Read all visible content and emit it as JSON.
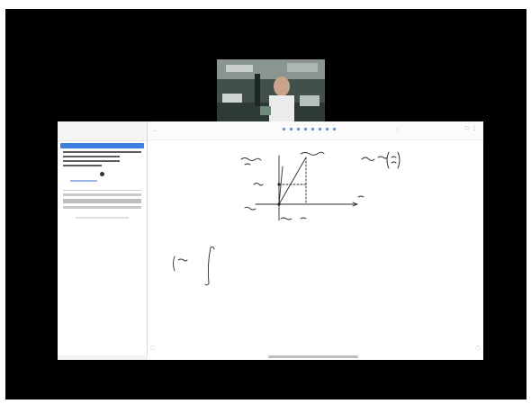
{
  "app": {
    "mode": "screen-recording",
    "accent_color": "#3d7fe0"
  },
  "webcam": {
    "icon": "person-webcam-icon"
  },
  "sidebar": {
    "top_text": "",
    "active_item": ""
  },
  "toolbar": {
    "left_icon": "back-arrow-icon",
    "tools": [
      "pen-icon",
      "eraser-icon",
      "shape-icon",
      "text-icon",
      "select-icon",
      "color-icon",
      "undo-icon",
      "redo-icon"
    ],
    "right_icons": [
      "share-icon",
      "more-icon"
    ]
  },
  "canvas": {
    "handwriting_is_illegible": true
  }
}
